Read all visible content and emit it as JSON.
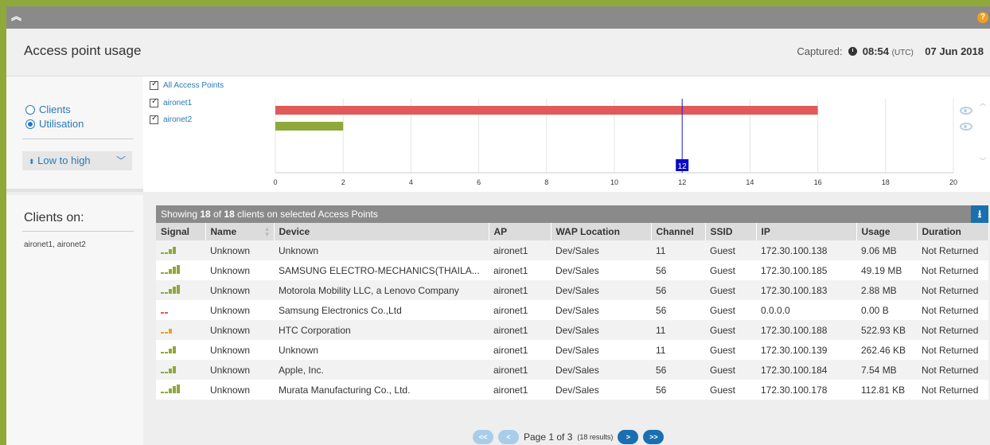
{
  "topbar": {
    "collapse_icon": "double-chevron-up-icon",
    "help_label": "?"
  },
  "header": {
    "title": "Access point usage",
    "captured_label": "Captured:",
    "captured_time": "08:54",
    "captured_tz": "(UTC)",
    "captured_date": "07 Jun 2018"
  },
  "controls": {
    "mode_options": [
      "Clients",
      "Utilisation"
    ],
    "selected_mode": "Utilisation",
    "sort_label": "Low to high"
  },
  "clients_on": {
    "heading": "Clients on:",
    "value": "aironet1, aironet2"
  },
  "ap_filter": {
    "all_label": "All Access Points",
    "items": [
      "aironet1",
      "aironet2"
    ]
  },
  "colors": {
    "accent": "#1a6fb0",
    "aironet1_bar": "#e05a5a",
    "aironet2_bar": "#8fa83a",
    "frame": "#8fa83a"
  },
  "chart_data": {
    "type": "bar",
    "orientation": "horizontal",
    "categories": [
      "aironet1",
      "aironet2"
    ],
    "values": [
      16,
      2
    ],
    "xlim": [
      0,
      20
    ],
    "xticks": [
      "0",
      "2",
      "4",
      "6",
      "8",
      "10",
      "12",
      "14",
      "16",
      "18",
      "20"
    ],
    "marker_value": 12,
    "marker_label": "12",
    "grid": true
  },
  "table": {
    "summary_prefix": "Showing ",
    "shown": "18",
    "summary_of": " of ",
    "total": "18",
    "summary_suffix": " clients on selected Access Points",
    "download_icon": "download-icon",
    "columns": [
      "Signal",
      "Name",
      "Device",
      "AP",
      "WAP Location",
      "Channel",
      "SSID",
      "IP",
      "Usage",
      "Duration"
    ],
    "rows": [
      {
        "signal": 3,
        "name": "Unknown",
        "device": "Unknown",
        "ap": "aironet1",
        "location": "Dev/Sales",
        "channel": "11",
        "ssid": "Guest",
        "ip": "172.30.100.138",
        "usage": "9.06 MB",
        "duration": "Not Returned"
      },
      {
        "signal": 4,
        "name": "Unknown",
        "device": "SAMSUNG ELECTRO-MECHANICS(THAILA...",
        "ap": "aironet1",
        "location": "Dev/Sales",
        "channel": "56",
        "ssid": "Guest",
        "ip": "172.30.100.185",
        "usage": "49.19 MB",
        "duration": "Not Returned"
      },
      {
        "signal": 4,
        "name": "Unknown",
        "device": "Motorola Mobility LLC, a Lenovo Company",
        "ap": "aironet1",
        "location": "Dev/Sales",
        "channel": "56",
        "ssid": "Guest",
        "ip": "172.30.100.183",
        "usage": "2.88 MB",
        "duration": "Not Returned"
      },
      {
        "signal": 1,
        "name": "Unknown",
        "device": "Samsung Electronics Co.,Ltd",
        "ap": "aironet1",
        "location": "Dev/Sales",
        "channel": "56",
        "ssid": "Guest",
        "ip": "0.0.0.0",
        "usage": "0.00 B",
        "duration": "Not Returned"
      },
      {
        "signal": 2,
        "name": "Unknown",
        "device": "HTC Corporation",
        "ap": "aironet1",
        "location": "Dev/Sales",
        "channel": "11",
        "ssid": "Guest",
        "ip": "172.30.100.188",
        "usage": "522.93 KB",
        "duration": "Not Returned"
      },
      {
        "signal": 3,
        "name": "Unknown",
        "device": "Unknown",
        "ap": "aironet1",
        "location": "Dev/Sales",
        "channel": "11",
        "ssid": "Guest",
        "ip": "172.30.100.139",
        "usage": "262.46 KB",
        "duration": "Not Returned"
      },
      {
        "signal": 3,
        "name": "Unknown",
        "device": "Apple, Inc.",
        "ap": "aironet1",
        "location": "Dev/Sales",
        "channel": "56",
        "ssid": "Guest",
        "ip": "172.30.100.184",
        "usage": "7.54 MB",
        "duration": "Not Returned"
      },
      {
        "signal": 4,
        "name": "Unknown",
        "device": "Murata Manufacturing Co., Ltd.",
        "ap": "aironet1",
        "location": "Dev/Sales",
        "channel": "56",
        "ssid": "Guest",
        "ip": "172.30.100.178",
        "usage": "112.81 KB",
        "duration": "Not Returned"
      }
    ]
  },
  "pagination": {
    "first": "<<",
    "prev": "<",
    "next": ">",
    "last": ">>",
    "page_text": "Page 1 of 3",
    "results_text": "(18 results)"
  }
}
